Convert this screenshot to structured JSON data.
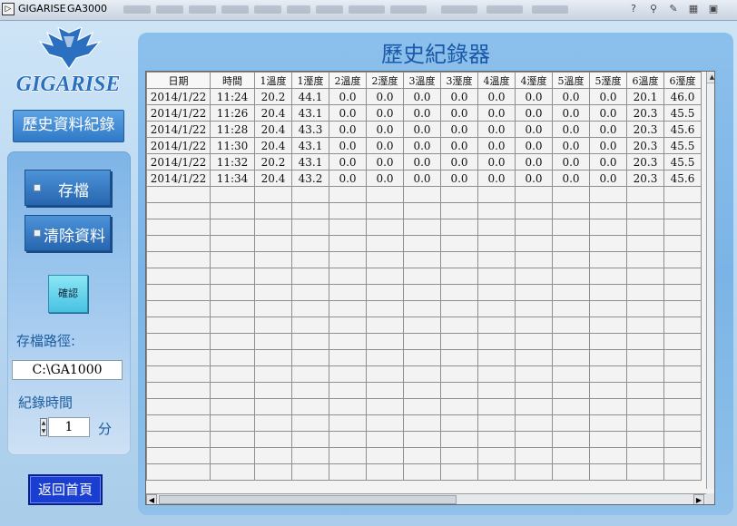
{
  "window": {
    "icon_glyph": "▷",
    "app_name": "GIGARISE",
    "title": "GA3000"
  },
  "sidebar": {
    "logo_text": "GIGARISE",
    "page_chip": "歷史資料紀錄",
    "save_button": "存檔",
    "clear_button": "清除資料",
    "confirm_button": "確認",
    "save_path_label": "存檔路徑:",
    "save_path_value": "C:\\GA1000",
    "record_time_label": "紀錄時間",
    "record_time_value": "1",
    "record_time_unit": "分",
    "home_button": "返回首頁"
  },
  "main": {
    "title": "歷史紀錄器",
    "columns": [
      "日期",
      "時間",
      "1溫度",
      "1溼度",
      "2溫度",
      "2溼度",
      "3溫度",
      "3溼度",
      "4溫度",
      "4溼度",
      "5溫度",
      "5溼度",
      "6溫度",
      "6溼度"
    ],
    "rows": [
      [
        "2014/1/22",
        "11:24",
        "20.2",
        "44.1",
        "0.0",
        "0.0",
        "0.0",
        "0.0",
        "0.0",
        "0.0",
        "0.0",
        "0.0",
        "20.1",
        "46.0"
      ],
      [
        "2014/1/22",
        "11:26",
        "20.4",
        "43.1",
        "0.0",
        "0.0",
        "0.0",
        "0.0",
        "0.0",
        "0.0",
        "0.0",
        "0.0",
        "20.3",
        "45.5"
      ],
      [
        "2014/1/22",
        "11:28",
        "20.4",
        "43.3",
        "0.0",
        "0.0",
        "0.0",
        "0.0",
        "0.0",
        "0.0",
        "0.0",
        "0.0",
        "20.3",
        "45.6"
      ],
      [
        "2014/1/22",
        "11:30",
        "20.4",
        "43.1",
        "0.0",
        "0.0",
        "0.0",
        "0.0",
        "0.0",
        "0.0",
        "0.0",
        "0.0",
        "20.3",
        "45.5"
      ],
      [
        "2014/1/22",
        "11:32",
        "20.2",
        "43.1",
        "0.0",
        "0.0",
        "0.0",
        "0.0",
        "0.0",
        "0.0",
        "0.0",
        "0.0",
        "20.3",
        "45.5"
      ],
      [
        "2014/1/22",
        "11:34",
        "20.4",
        "43.2",
        "0.0",
        "0.0",
        "0.0",
        "0.0",
        "0.0",
        "0.0",
        "0.0",
        "0.0",
        "20.3",
        "45.6"
      ]
    ],
    "scroll_up_glyph": "▲",
    "scroll_left_glyph": "◀",
    "scroll_right_glyph": "▶"
  },
  "colors": {
    "accent": "#2f79c7",
    "title_text": "#1b5aa8",
    "home_button": "#1a3fd0"
  }
}
